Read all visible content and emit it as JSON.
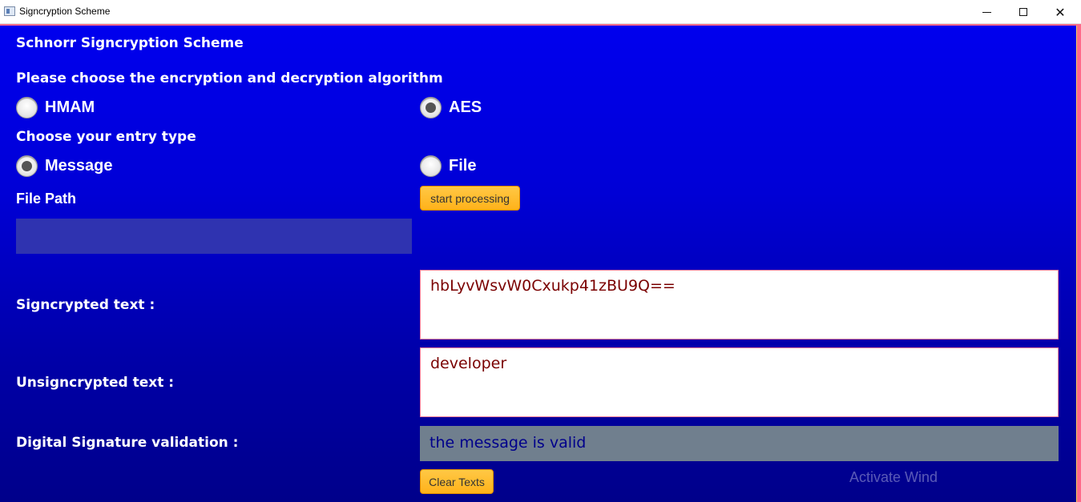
{
  "window": {
    "title": "Signcryption Scheme",
    "minimize_icon": "minimize-icon",
    "maximize_icon": "maximize-icon",
    "close_icon": "close-icon"
  },
  "app": {
    "heading": "Schnorr Signcryption Scheme",
    "algorithm_prompt": "Please choose the encryption and decryption algorithm",
    "algorithm_options": [
      {
        "label": "HMAM",
        "selected": false
      },
      {
        "label": "AES",
        "selected": true
      }
    ],
    "entry_prompt": "Choose your entry type",
    "entry_options": [
      {
        "label": "Message",
        "selected": true
      },
      {
        "label": "File",
        "selected": false
      }
    ],
    "file_path_label": "File Path",
    "file_path_value": "",
    "start_button": "start processing",
    "signcrypted_label": "Signcrypted text :",
    "signcrypted_value": "hbLyvWsvW0Cxukp41zBU9Q==",
    "unsigncrypted_label": "Unsigncrypted text :",
    "unsigncrypted_value": "developer",
    "validation_label": "Digital Signature validation :",
    "validation_value": "the message is valid",
    "clear_button": "Clear Texts",
    "watermark": "Activate Wind"
  },
  "colors": {
    "background_top": "#0000ee",
    "background_bottom": "#00008a",
    "accent_button": "#ffb21a",
    "textarea_text": "#7a0000",
    "validation_bg": "#707f8e"
  }
}
